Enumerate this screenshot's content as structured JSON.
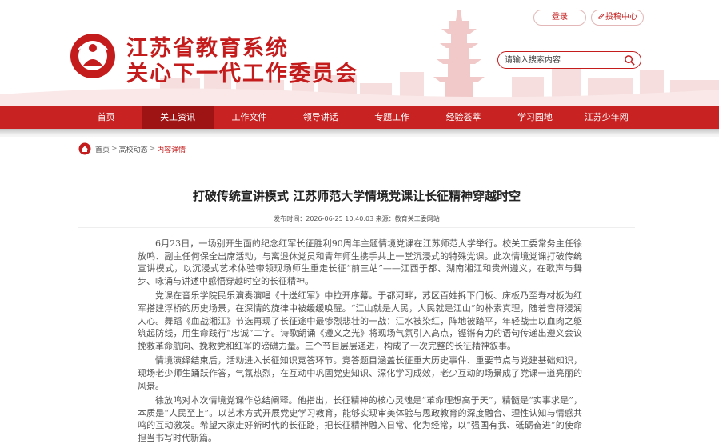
{
  "header": {
    "title_line1": "江苏省教育系统",
    "title_line2": "关心下一代工作委员会",
    "login_label": "登录",
    "submit_label": "投稿中心",
    "search_placeholder": "请输入搜索内容",
    "brand_color": "#c41c1c"
  },
  "nav": {
    "items": [
      {
        "label": "首页"
      },
      {
        "label": "关工资讯"
      },
      {
        "label": "工作文件"
      },
      {
        "label": "领导讲话"
      },
      {
        "label": "专题工作"
      },
      {
        "label": "经验荟萃"
      },
      {
        "label": "学习园地"
      },
      {
        "label": "江苏少年网"
      }
    ],
    "active_index": 1
  },
  "breadcrumb": {
    "home": "首页",
    "section": "高校动态",
    "current": "内容详情",
    "separator": ">"
  },
  "article": {
    "title": "打破传统宣讲模式 江苏师范大学情境党课让长征精神穿越时空",
    "meta": "发布时间：2026-06-25 10:40:03 来源：教育关工委网站",
    "paragraphs": [
      "6月23日，一场别开生面的纪念红军长征胜利90周年主题情境党课在江苏师范大学举行。校关工委常务主任徐放鸣、副主任何保全出席活动，与离退休党员和青年师生携手共上一堂沉浸式的特殊党课。此次情境党课打破传统宣讲模式，以沉浸式艺术体验带领现场师生重走长征“前三站”——江西于都、湖南湘江和贵州遵义，在歌声与舞步、咏诵与讲述中感悟穿越时空的长征精神。",
      "党课在音乐学院民乐演奏演唱《十送红军》中拉开序幕。于都河畔，苏区百姓拆下门板、床板乃至寿材板为红军搭建浮桥的历史场景，在深情的旋律中被缓缓唤醒。“江山就是人民，人民就是江山”的朴素真理，随着音符浸润人心。舞蹈《血战湘江》节选再现了长征途中最惨烈悲壮的一战：江水被染红，阵地被踏平，年轻战士以血肉之躯筑起防线，用生命践行“忠诚”二字。诗歌朗诵《遵义之光》将现场气氛引入高点，铿锵有力的语句传递出遵义会议挽救革命航向、挽救党和红军的磅礴力量。三个节目层层递进，构成了一次完整的长征精神叙事。",
      "情境演绎结束后，活动进入长征知识竞答环节。竞答题目涵盖长征重大历史事件、重要节点与党建基础知识，现场老少师生踊跃作答，气氛热烈，在互动中巩固党史知识、深化学习成效，老少互动的场景成了党课一道亮丽的风景。",
      "徐放鸣对本次情境党课作总结阐释。他指出，长征精神的核心灵魂是“革命理想高于天”，精髓是“实事求是”，本质是“人民至上”。以艺术方式开展党史学习教育，能够实现审美体验与思政教育的深度融合、理性认知与情感共鸣的互动激发。希望大家走好新时代的长征路，把长征精神融入日常、化为经常，以“强国有我、砥砺奋进”的使命担当书写时代新篇。"
    ]
  }
}
